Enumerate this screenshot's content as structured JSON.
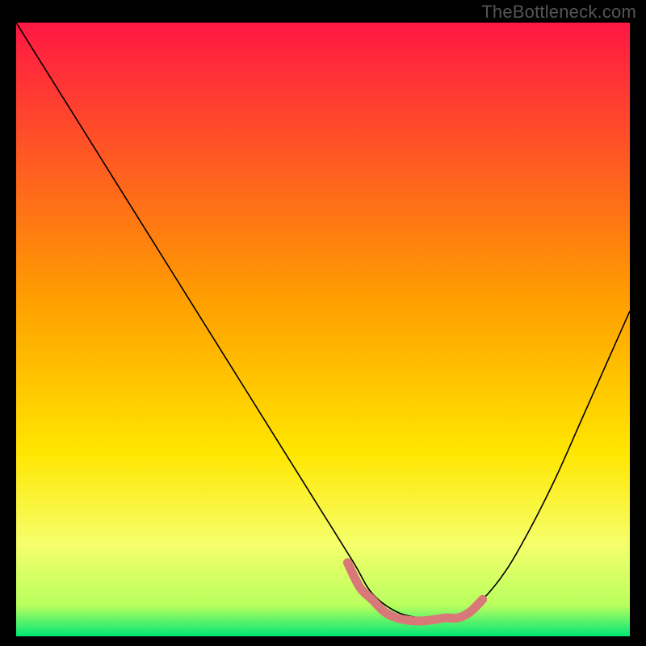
{
  "watermark": "TheBottleneck.com",
  "chart_data": {
    "type": "line",
    "title": "",
    "xlabel": "",
    "ylabel": "",
    "xlim": [
      0,
      100
    ],
    "ylim": [
      0,
      100
    ],
    "grid": false,
    "legend": false,
    "background_gradient": {
      "orientation": "vertical",
      "stops": [
        {
          "offset": 0.0,
          "color": "#ff1744"
        },
        {
          "offset": 0.45,
          "color": "#ff9e00"
        },
        {
          "offset": 0.7,
          "color": "#ffe600"
        },
        {
          "offset": 0.85,
          "color": "#f6ff6b"
        },
        {
          "offset": 0.95,
          "color": "#b8ff5e"
        },
        {
          "offset": 1.0,
          "color": "#00e676"
        }
      ]
    },
    "series": [
      {
        "name": "bottleneck-curve",
        "color": "#000000",
        "width": 1.6,
        "x": [
          0,
          5,
          10,
          15,
          20,
          25,
          30,
          35,
          40,
          45,
          50,
          55,
          58,
          62,
          66,
          70,
          72,
          76,
          80,
          84,
          88,
          92,
          96,
          100
        ],
        "values": [
          100,
          92,
          84,
          76,
          68,
          60,
          52,
          44,
          36,
          28,
          20,
          12,
          7,
          4,
          3,
          3,
          3,
          6,
          11,
          18,
          26,
          35,
          44,
          53
        ]
      },
      {
        "name": "valley-marker",
        "color": "#d97878",
        "width": 11,
        "linecap": "round",
        "x": [
          54,
          56,
          58,
          60,
          62,
          64,
          66,
          68,
          70,
          72,
          74,
          76
        ],
        "values": [
          12,
          8,
          6,
          4,
          3,
          2.6,
          2.5,
          2.7,
          3,
          3,
          4,
          6
        ]
      }
    ]
  }
}
